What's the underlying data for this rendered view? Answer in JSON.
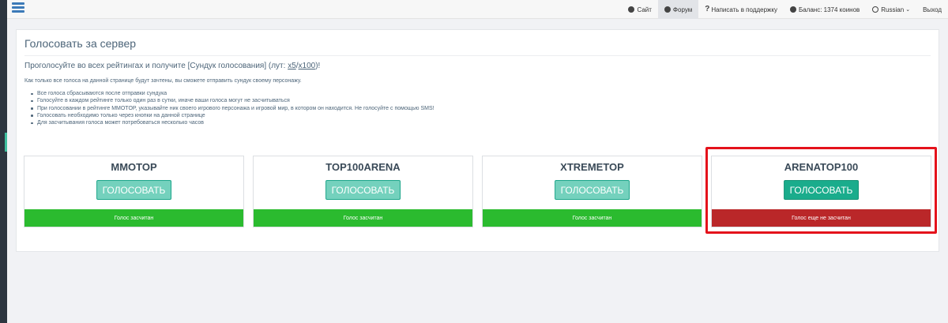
{
  "topbar": {
    "nav": [
      {
        "label": "Сайт",
        "icon": "circle-arrow-icon",
        "active": false
      },
      {
        "label": "Форум",
        "icon": "circle-arrow-icon",
        "active": true
      },
      {
        "label": "Написать в поддержку",
        "icon": "question-icon",
        "active": false
      },
      {
        "label": "Баланс: 1374 коинов",
        "icon": "coins-icon",
        "active": false
      },
      {
        "label": "Russian",
        "icon": "globe-icon",
        "active": false
      },
      {
        "label": "Выход",
        "icon": "",
        "active": false
      }
    ]
  },
  "panel": {
    "title": "Голосовать за сервер",
    "lead_before": "Проголосуйте во всех рейтингах и получите [Сундук голосования] (лут: ",
    "lead_link1": "x5",
    "lead_slash": "/",
    "lead_link2": "x100",
    "lead_after": ")!",
    "sub": "Как только все голоса на данной странице будут зачтены, вы сможете отправить сундук своему персонажу.",
    "rules": [
      "Все голоса сбрасываются после отправки сундука",
      "Голосуйте в каждом рейтинге только один раз в сутки, иначе ваши голоса могут не засчитываться",
      "При голосовании в рейтинге MMOTOP, указывайте ник своего игрового персонажа и игровой мир, в котором он находится. Не голосуйте с помощью SMS!",
      "Голосовать необходимо только через кнопки на данной странице",
      "Для засчитывания голоса может потребоваться несколько часов"
    ]
  },
  "vote_sites": [
    {
      "name": "MMOTOP",
      "button": "ГОЛОСОВАТЬ",
      "status": "Голос засчитан"
    },
    {
      "name": "TOP100ARENA",
      "button": "ГОЛОСОВАТЬ",
      "status": "Голос засчитан"
    },
    {
      "name": "XTREMETOP",
      "button": "ГОЛОСОВАТЬ",
      "status": "Голос засчитан"
    },
    {
      "name": "ARENATOP100",
      "button": "ГОЛОСОВАТЬ",
      "status": "Голос еще не засчитан"
    }
  ],
  "colors": {
    "accent": "#1aac8c",
    "status_ok": "#2bbb2f",
    "status_pending": "#ba2729",
    "highlight": "#e4121b"
  }
}
